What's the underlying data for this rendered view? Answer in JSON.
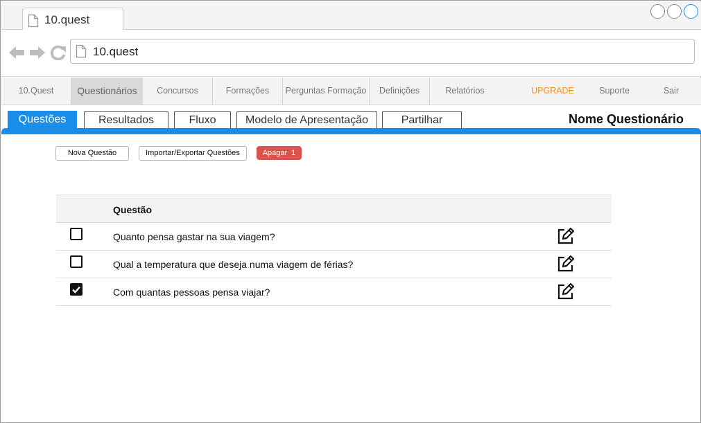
{
  "browser": {
    "tab_title": "10.quest",
    "url": "10.quest"
  },
  "nav": {
    "items": [
      {
        "label": "10.Quest"
      },
      {
        "label": "Questionários"
      },
      {
        "label": "Concursos"
      },
      {
        "label": "Formações"
      },
      {
        "label": "Perguntas Formação"
      },
      {
        "label": "Definições"
      },
      {
        "label": "Relatórios"
      },
      {
        "label": "UPGRADE"
      },
      {
        "label": "Suporte"
      },
      {
        "label": "Sair"
      }
    ],
    "active": "Questionários",
    "upgrade_color": "#f0901e"
  },
  "subtabs": {
    "items": [
      {
        "label": "Questões"
      },
      {
        "label": "Resultados"
      },
      {
        "label": "Fluxo"
      },
      {
        "label": "Modelo de Apresentação"
      },
      {
        "label": "Partilhar"
      }
    ],
    "active": "Questões",
    "accent_color": "#1a8de8"
  },
  "page_title": "Nome Questionário",
  "actions": {
    "new_question": "Nova Questão",
    "import_export": "Importar/Exportar Questões",
    "delete": "Apagar",
    "delete_count": "1",
    "delete_color": "#d9534f"
  },
  "table": {
    "header": "Questão",
    "rows": [
      {
        "text": "Quanto pensa gastar na sua viagem?",
        "checked": false
      },
      {
        "text": "Qual a temperatura que deseja numa viagem de férias?",
        "checked": false
      },
      {
        "text": "Com quantas pessoas pensa viajar?",
        "checked": true
      }
    ]
  }
}
